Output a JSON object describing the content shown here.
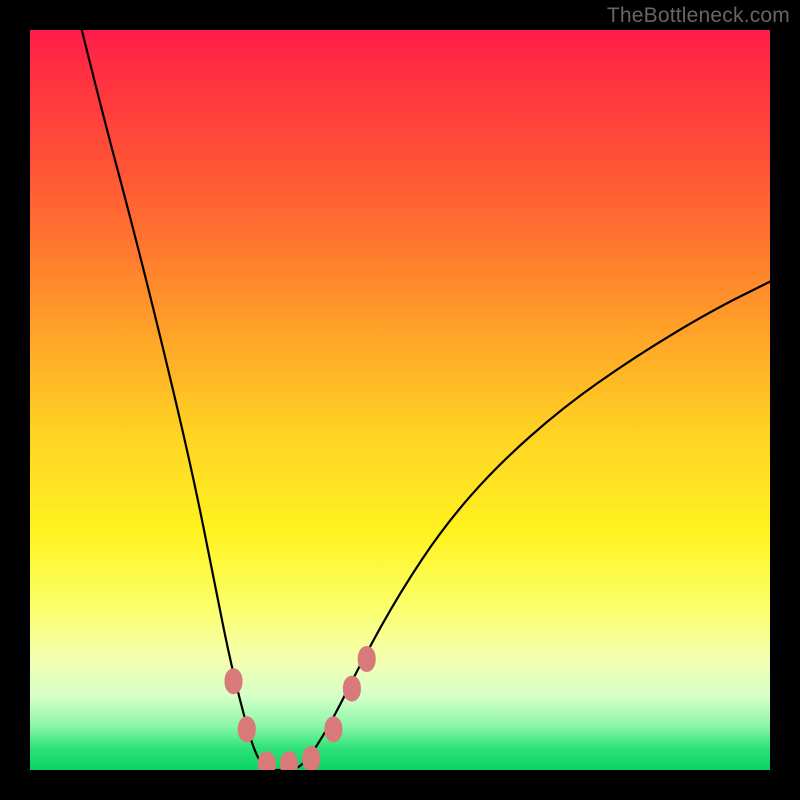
{
  "watermark": "TheBottleneck.com",
  "chart_data": {
    "type": "line",
    "title": "",
    "xlabel": "",
    "ylabel": "",
    "xlim": [
      0,
      100
    ],
    "ylim": [
      0,
      100
    ],
    "series": [
      {
        "name": "bottleneck-curve",
        "x": [
          7,
          10,
          14,
          18,
          22,
          25,
          27,
          29,
          30.5,
          32,
          34,
          36,
          38,
          41,
          45,
          50,
          56,
          63,
          72,
          82,
          92,
          100
        ],
        "y": [
          100,
          88,
          73,
          57,
          40,
          25,
          15,
          7,
          2,
          0,
          0,
          0,
          2,
          7,
          15,
          24,
          33,
          41,
          49,
          56,
          62,
          66
        ]
      }
    ],
    "markers": [
      {
        "name": "left-upper",
        "x": 27.5,
        "y": 12
      },
      {
        "name": "left-lower",
        "x": 29.3,
        "y": 5.5
      },
      {
        "name": "trough-1",
        "x": 32.0,
        "y": 0.8
      },
      {
        "name": "trough-2",
        "x": 35.0,
        "y": 0.8
      },
      {
        "name": "trough-3",
        "x": 38.0,
        "y": 1.5
      },
      {
        "name": "right-lower",
        "x": 41.0,
        "y": 5.5
      },
      {
        "name": "right-mid",
        "x": 43.5,
        "y": 11
      },
      {
        "name": "right-upper",
        "x": 45.5,
        "y": 15
      }
    ],
    "marker_color": "#d87a7a",
    "curve_color": "#000000",
    "gradient_stops": [
      {
        "pos": 0,
        "color": "#ff1c4a"
      },
      {
        "pos": 18,
        "color": "#ff5236"
      },
      {
        "pos": 42,
        "color": "#ffa728"
      },
      {
        "pos": 68,
        "color": "#fff320"
      },
      {
        "pos": 90,
        "color": "#d6ffc8"
      },
      {
        "pos": 100,
        "color": "#09d362"
      }
    ]
  }
}
